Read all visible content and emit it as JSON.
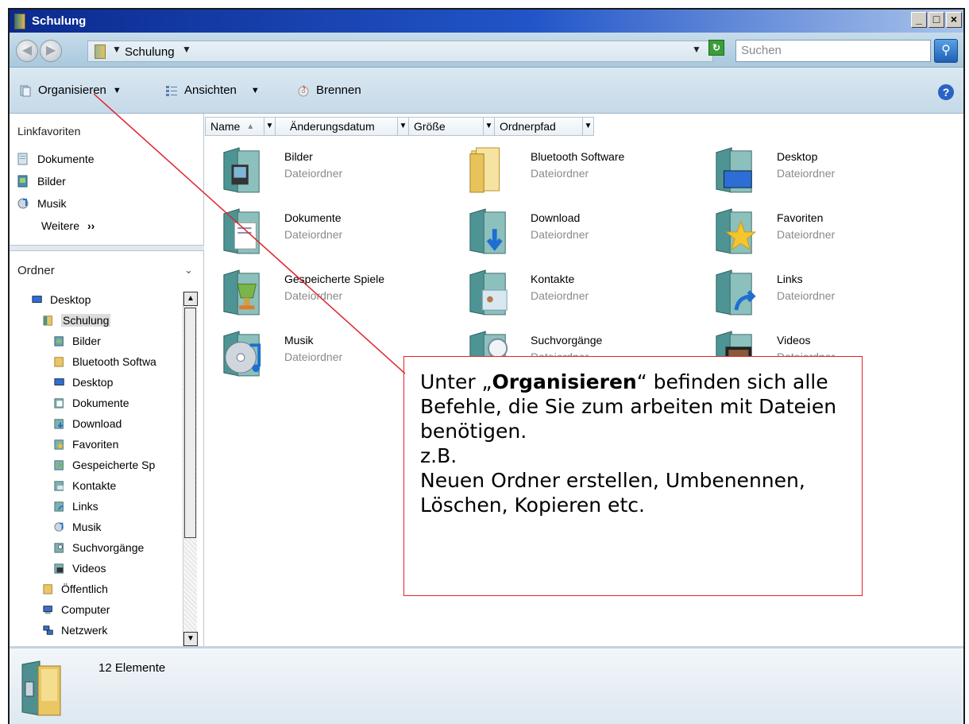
{
  "window": {
    "title": "Schulung",
    "buttons": {
      "minimize": "_",
      "maximize": "□",
      "close": "×"
    }
  },
  "address": {
    "crumb": "Schulung",
    "search_placeholder": "Suchen"
  },
  "toolbar": {
    "organize": "Organisieren",
    "views": "Ansichten",
    "burn": "Brennen",
    "help": "?"
  },
  "favorites": {
    "title": "Linkfavoriten",
    "items": [
      "Dokumente",
      "Bilder",
      "Musik"
    ],
    "more": "Weitere"
  },
  "folders": {
    "title": "Ordner",
    "tree": [
      {
        "label": "Desktop"
      },
      {
        "label": "Schulung"
      },
      {
        "label": "Bilder"
      },
      {
        "label": "Bluetooth Softwa"
      },
      {
        "label": "Desktop"
      },
      {
        "label": "Dokumente"
      },
      {
        "label": "Download"
      },
      {
        "label": "Favoriten"
      },
      {
        "label": "Gespeicherte Sp"
      },
      {
        "label": "Kontakte"
      },
      {
        "label": "Links"
      },
      {
        "label": "Musik"
      },
      {
        "label": "Suchvorgänge"
      },
      {
        "label": "Videos"
      },
      {
        "label": "Öffentlich"
      },
      {
        "label": "Computer"
      },
      {
        "label": "Netzwerk"
      }
    ]
  },
  "columns": [
    "Name",
    "Änderungsdatum",
    "Größe",
    "Ordnerpfad"
  ],
  "items": [
    {
      "name": "Bilder",
      "type": "Dateiordner"
    },
    {
      "name": "Bluetooth Software",
      "type": "Dateiordner"
    },
    {
      "name": "Desktop",
      "type": "Dateiordner"
    },
    {
      "name": "Dokumente",
      "type": "Dateiordner"
    },
    {
      "name": "Download",
      "type": "Dateiordner"
    },
    {
      "name": "Favoriten",
      "type": "Dateiordner"
    },
    {
      "name": "Gespeicherte Spiele",
      "type": "Dateiordner"
    },
    {
      "name": "Kontakte",
      "type": "Dateiordner"
    },
    {
      "name": "Links",
      "type": "Dateiordner"
    },
    {
      "name": "Musik",
      "type": "Dateiordner"
    },
    {
      "name": "Suchvorgänge",
      "type": "Dateiordner"
    },
    {
      "name": "Videos",
      "type": "Dateiordner"
    }
  ],
  "status": {
    "count": "12 Elemente"
  },
  "callout": {
    "prefix": "Unter „",
    "bold": "Organisieren",
    "suffix": "“ befinden sich alle Befehle, die Sie zum arbeiten mit Dateien benötigen.",
    "line2": "z.B.",
    "line3": "Neuen Ordner erstellen, Umbenennen, Löschen, Kopieren etc."
  },
  "colors": {
    "annotation_red": "#e0252a",
    "title_blue": "#0b2a8e"
  }
}
